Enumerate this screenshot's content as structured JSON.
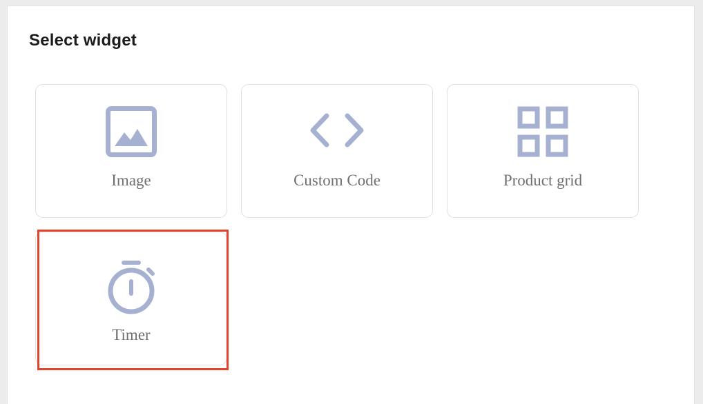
{
  "panel": {
    "title": "Select widget"
  },
  "widgets": [
    {
      "label": "Image",
      "icon": "image-icon"
    },
    {
      "label": "Custom Code",
      "icon": "code-icon"
    },
    {
      "label": "Product grid",
      "icon": "grid-icon"
    },
    {
      "label": "Timer",
      "icon": "stopwatch-icon"
    }
  ],
  "colors": {
    "icon": "#a6b1d1",
    "tile_border": "#dde0e6",
    "label": "#6f6f6f",
    "highlight": "#e2432a"
  }
}
